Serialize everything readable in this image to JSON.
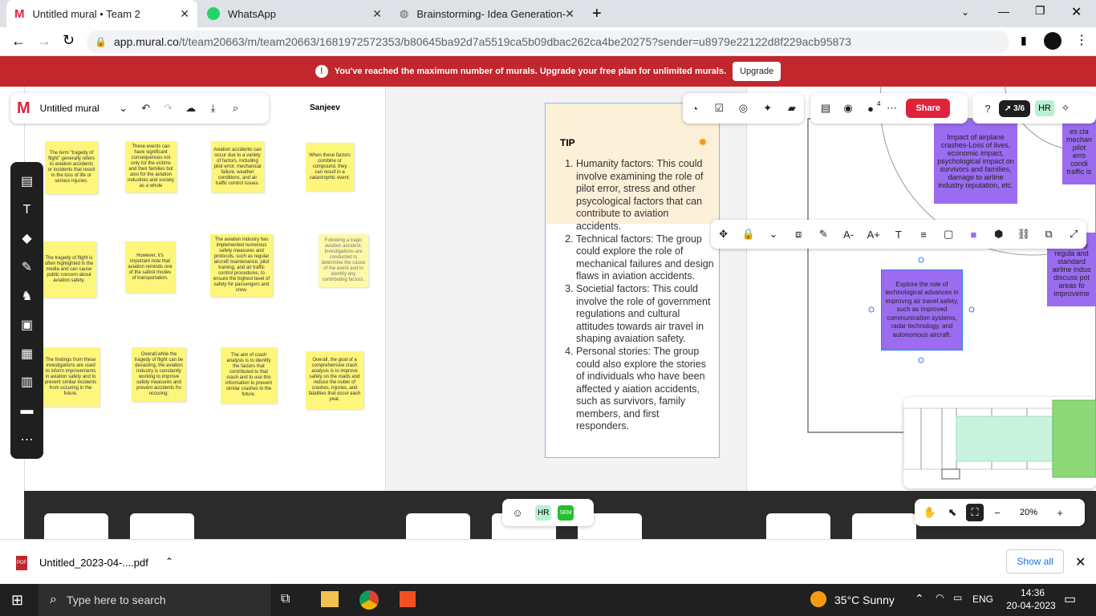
{
  "browser": {
    "tabs": [
      {
        "title": "Untitled mural • Team 2",
        "icon": "mural-icon"
      },
      {
        "title": "WhatsApp",
        "icon": "whatsapp-icon"
      },
      {
        "title": "Brainstorming- Idea Generation-",
        "icon": "globe-icon"
      }
    ],
    "url_host": "app.mural.co",
    "url_path": "/t/team20663/m/team20663/1681972572353/b80645ba92d7a5519ca5b09dbac262ca4be20275?sender=u8979e22122d8f229acb95873"
  },
  "banner": {
    "message": "You've reached the maximum number of murals. Upgrade your free plan for unlimited murals.",
    "button": "Upgrade"
  },
  "topbar": {
    "mural_title": "Untitled mural",
    "user_label": "Sanjeev",
    "share": "Share",
    "count": "3/6",
    "avatar": "HR",
    "badge": "4"
  },
  "stickies": [
    "The term \"tragedy of flight\" generally refers to aviation accidents or incidents that result in the loss of life or serious injuries.",
    "These events can have significant consequences not only for the victims and their families but also for the aviation industries and society as a whole",
    "Aviation accidents can occur due to a variety of factors, including pilot error, mechanical failure, weather conditions, and air traffic control issues.",
    "When these factors combine or compound, they can result in a catastrophic event.",
    "The tragedy of flight is often highlighted in the media and can cause public concern about aviation safety.",
    "However, it's important note that aviation reminds one of the safest modes of transportation.",
    "The aviation industry has implemented numerous safety measures and protocols, such as regular aircraft maintenance, pilot training, and air traffic control procedures, to ensure the highest level of safety for passengers and crew.",
    "Following a tragic aviation accident, investigations are conducted to determine the cause of the event and to identify any contributing factors.",
    "The findings from these investigations are used to inform improvements in aviation safety and to prevent similar incidents from occuring in the future.",
    "Overall,while the tragedy of flight can be devasting, the aviation industry is constantly working to improve safety measures and prevent accidents fro occuring.",
    "The aim of crash analysis is to identify the factors that contributed to that crash and to use this information to prevent similar crashes in the future.",
    "Overall, the goal of a comprehensive crash analysis is to improve safety on the roads and reduce the nuber of crashes, injuries, and fatalities that occur each year."
  ],
  "tip": {
    "heading": "TIP",
    "items": [
      "Humanity factors: This could involve examining the role of pilot error, stress and other psycological factors that can contribute to aviation accidents.",
      "Technical factors: The group could explore the role of mechanical failures and design flaws in aviation accidents.",
      "Societial factors: This could involve the role of government regulations and cultural attitudes towards air travel in shaping avaiation safety.",
      "Personal stories: The group could also explore the stories of individuals who have been affected y aiation accidents, such as survivors, family members, and first responders."
    ]
  },
  "purple_notes": {
    "impact": "Impact of airplane crashes-Loss of lives, economic impact, psychological impact on survivors and families, damage to airline industry reputation, etc.",
    "selected": "Explore the role of technological advances in improvng air travel safety, such as improved communication systems, radar technology, and autonomous aircraft.",
    "right_top": "es cla mechan pilot erro condi traffic is",
    "right_mid": "eco safety regula and standard airline indus discuss pot areas fo improveme"
  },
  "zoom": {
    "value": "20%"
  },
  "collab": {
    "avatar1": "HR",
    "avatar2": "SEM"
  },
  "download": {
    "file": "Untitled_2023-04-....pdf",
    "show_all": "Show all"
  },
  "taskbar": {
    "search_placeholder": "Type here to search",
    "weather": "35°C  Sunny",
    "lang": "ENG",
    "time": "14:36",
    "date": "20-04-2023"
  },
  "colors": {
    "banner": "#c1272d",
    "sticky": "#fdf67a",
    "purple": "#9b6cf0",
    "share": "#e0223a"
  }
}
